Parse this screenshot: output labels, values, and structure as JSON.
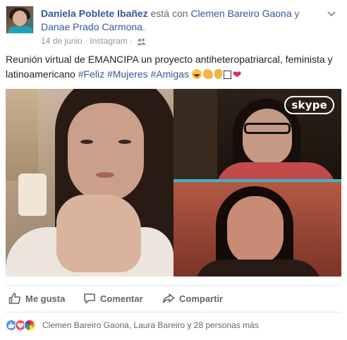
{
  "header": {
    "author": "Daniela Poblete Ibañez",
    "with_text": "está con",
    "tagged_1": "Clemen Bareiro Gaona",
    "and_text": "y",
    "tagged_2": "Danae Prado Carmona",
    "period": ".",
    "date": "14 de junio",
    "separator": "·",
    "source": "Instagram",
    "separator2": "·",
    "audience_icon": "friends-icon",
    "options_icon": "chevron-down-icon"
  },
  "post": {
    "text": "Reunión virtual de EMANCIPA un proyecto antiheteropatriarcal, feminista y latinoamericano",
    "hashtags": [
      "#Feliz",
      "#Mujeres",
      "#Amigas"
    ],
    "emojis": [
      "grinning-face",
      "flexed-biceps",
      "ok-hand",
      "box",
      "red-heart"
    ]
  },
  "photo": {
    "overlay_logo": "skype"
  },
  "actions": {
    "like": "Me gusta",
    "comment": "Comentar",
    "share": "Compartir"
  },
  "reactions": {
    "icons": [
      "like-reaction-icon",
      "love-reaction-icon",
      "pride-reaction-icon"
    ],
    "summary": "Clemen Bareiro Gaona, Laura Bareiro y 28 personas más"
  },
  "colors": {
    "link": "#365899",
    "meta": "#90949c",
    "text": "#1d2129",
    "action": "#606770",
    "like_blue": "#5890ff",
    "love_red": "#f25268"
  }
}
